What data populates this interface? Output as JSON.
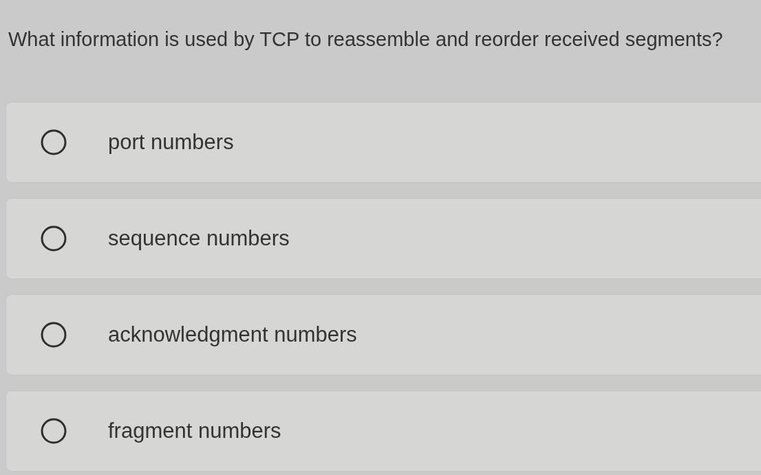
{
  "question": "What information is used by TCP to reassemble and reorder received segments?",
  "options": [
    {
      "label": "port numbers",
      "selected": false
    },
    {
      "label": "sequence numbers",
      "selected": false
    },
    {
      "label": "acknowledgment numbers",
      "selected": false
    },
    {
      "label": "fragment numbers",
      "selected": false
    }
  ]
}
